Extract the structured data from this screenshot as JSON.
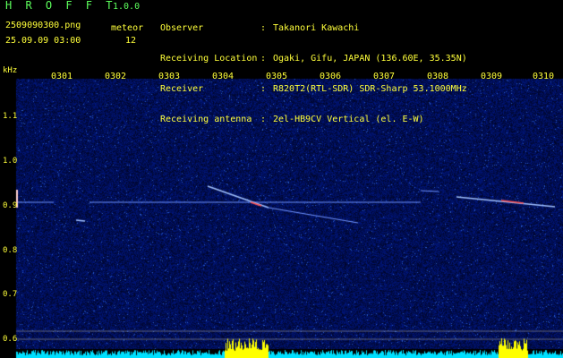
{
  "header": {
    "app_title": "H R O F F T",
    "version": "1.0.0",
    "filename": "2509090300.png",
    "datetime": "25.09.09 03:00",
    "meteor_label": "meteor",
    "meteor_count": "12"
  },
  "info": [
    {
      "key": "Observer",
      "value": "Takanori Kawachi"
    },
    {
      "key": "Receiving Location",
      "value": "Ogaki, Gifu, JAPAN (136.60E, 35.35N)"
    },
    {
      "key": "Receiver",
      "value": "R820T2(RTL-SDR) SDR-Sharp 53.1000MHz"
    },
    {
      "key": "Receiving antenna",
      "value": "2el-HB9CV Vertical (el. E-W)"
    }
  ],
  "axis": {
    "y_unit": "kHz",
    "y_ticks": [
      "1.1",
      "1.0",
      "0.9",
      "0.8",
      "0.7",
      "0.6"
    ],
    "x_ticks": [
      "0301",
      "0302",
      "0303",
      "0304",
      "0305",
      "0306",
      "0307",
      "0308",
      "0309",
      "0310"
    ]
  },
  "colors": {
    "background": "#000000",
    "noise": "#0a0f6e",
    "signal_line": "#7fa8ff",
    "axis_label": "#ffff3a",
    "title": "#5cff5c",
    "activity_yellow": "#ffff00",
    "activity_cyan": "#00e0ff"
  }
}
